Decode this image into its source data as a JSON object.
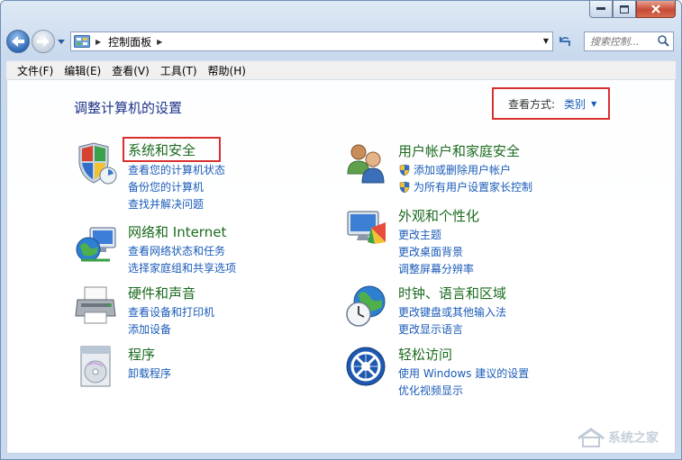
{
  "window": {
    "title_icon": "control-panel-icon"
  },
  "nav": {
    "address_path": "控制面板",
    "search_placeholder": "搜索控制...",
    "breadcrumb_icon": "control-panel-icon"
  },
  "menu": {
    "items": [
      "文件(F)",
      "编辑(E)",
      "查看(V)",
      "工具(T)",
      "帮助(H)"
    ]
  },
  "main": {
    "title": "调整计算机的设置",
    "view_mode_label": "查看方式:",
    "view_mode_value": "类别"
  },
  "categories": [
    {
      "title": "系统和安全",
      "icon": "shield-computer-icon",
      "links": [
        "查看您的计算机状态",
        "备份您的计算机",
        "查找并解决问题"
      ]
    },
    {
      "title": "网络和 Internet",
      "icon": "network-globe-icon",
      "links": [
        "查看网络状态和任务",
        "选择家庭组和共享选项"
      ]
    },
    {
      "title": "硬件和声音",
      "icon": "printer-icon",
      "links": [
        "查看设备和打印机",
        "添加设备"
      ]
    },
    {
      "title": "程序",
      "icon": "programs-disc-icon",
      "links": [
        "卸载程序"
      ]
    },
    {
      "title": "用户帐户和家庭安全",
      "icon": "users-icon",
      "links": [
        "添加或删除用户帐户",
        "为所有用户设置家长控制"
      ]
    },
    {
      "title": "外观和个性化",
      "icon": "monitor-palette-icon",
      "links": [
        "更改主题",
        "更改桌面背景",
        "调整屏幕分辨率"
      ]
    },
    {
      "title": "时钟、语言和区域",
      "icon": "globe-clock-icon",
      "links": [
        "更改键盘或其他输入法",
        "更改显示语言"
      ]
    },
    {
      "title": "轻松访问",
      "icon": "ease-of-access-icon",
      "links": [
        "使用 Windows 建议的设置",
        "优化视频显示"
      ]
    }
  ],
  "watermark": {
    "text": "系统之家"
  },
  "colors": {
    "title_green": "#1b6b1e",
    "link_blue": "#1a5bb8",
    "highlight_red": "#d9302f",
    "heading_blue": "#1e3287"
  }
}
